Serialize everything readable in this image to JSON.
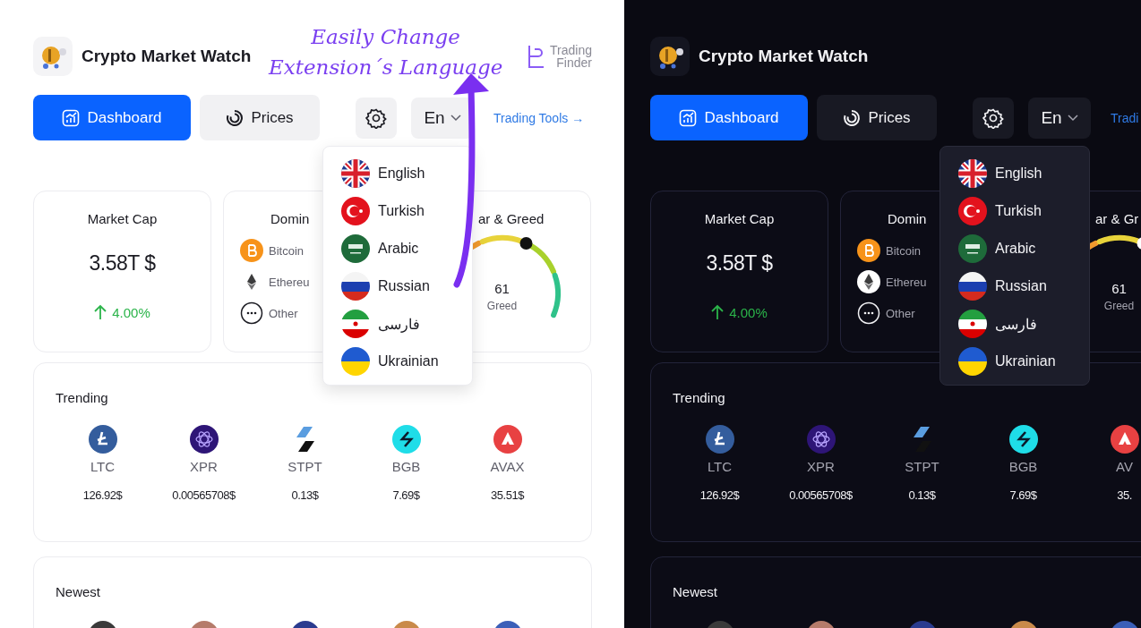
{
  "annotation": {
    "line_1": "Easily Change",
    "line_2": "Extension´s Language"
  },
  "panels": [
    {
      "kind": "light",
      "app_title": "Crypto Market Watch",
      "brand_logo": {
        "line_1": "Trading",
        "line_2": "Finder"
      },
      "nav": [
        {
          "label": "Dashboard",
          "selected": true
        },
        {
          "label": "Prices",
          "selected": false
        }
      ],
      "language_button": "En",
      "trading_tools_link": "Trading Tools →",
      "language_menu": [
        {
          "label": "English"
        },
        {
          "label": "Turkish"
        },
        {
          "label": "Arabic"
        },
        {
          "label": "Russian"
        },
        {
          "label": "فارسی"
        },
        {
          "label": "Ukrainian"
        }
      ],
      "market_cap": {
        "title": "Market Cap",
        "value": "3.58T $",
        "change": "4.00%"
      },
      "dominance": {
        "title": "Domin",
        "items": [
          "Bitcoin",
          "Ethereu",
          "Other"
        ]
      },
      "fear_greed": {
        "title": "ar & Greed",
        "value": "61",
        "label": "Greed",
        "level": 0.61
      },
      "trending": {
        "title": "Trending",
        "coins": [
          {
            "symbol": "LTC",
            "price": "126.92$"
          },
          {
            "symbol": "XPR",
            "price": "0.00565708$"
          },
          {
            "symbol": "STPT",
            "price": "0.13$"
          },
          {
            "symbol": "BGB",
            "price": "7.69$"
          },
          {
            "symbol": "AVAX",
            "price": "35.51$"
          }
        ]
      },
      "newest": {
        "title": "Newest"
      }
    },
    {
      "kind": "dark",
      "app_title": "Crypto Market Watch",
      "nav": [
        {
          "label": "Dashboard",
          "selected": true
        },
        {
          "label": "Prices",
          "selected": false
        }
      ],
      "language_button": "En",
      "trading_tools_link": "Tradi",
      "language_menu": [
        {
          "label": "English"
        },
        {
          "label": "Turkish"
        },
        {
          "label": "Arabic"
        },
        {
          "label": "Russian"
        },
        {
          "label": "فارسی"
        },
        {
          "label": "Ukrainian"
        }
      ],
      "market_cap": {
        "title": "Market Cap",
        "value": "3.58T $",
        "change": "4.00%"
      },
      "dominance": {
        "title": "Domin",
        "items": [
          "Bitcoin",
          "Ethereu",
          "Other"
        ]
      },
      "fear_greed": {
        "title": "ar & Gr",
        "value": "61",
        "label": "Greed",
        "level": 0.61
      },
      "trending": {
        "title": "Trending",
        "coins": [
          {
            "symbol": "LTC",
            "price": "126.92$"
          },
          {
            "symbol": "XPR",
            "price": "0.00565708$"
          },
          {
            "symbol": "STPT",
            "price": "0.13$"
          },
          {
            "symbol": "BGB",
            "price": "7.69$"
          },
          {
            "symbol": "AV",
            "price": "35."
          }
        ]
      },
      "newest": {
        "title": "Newest"
      }
    }
  ]
}
